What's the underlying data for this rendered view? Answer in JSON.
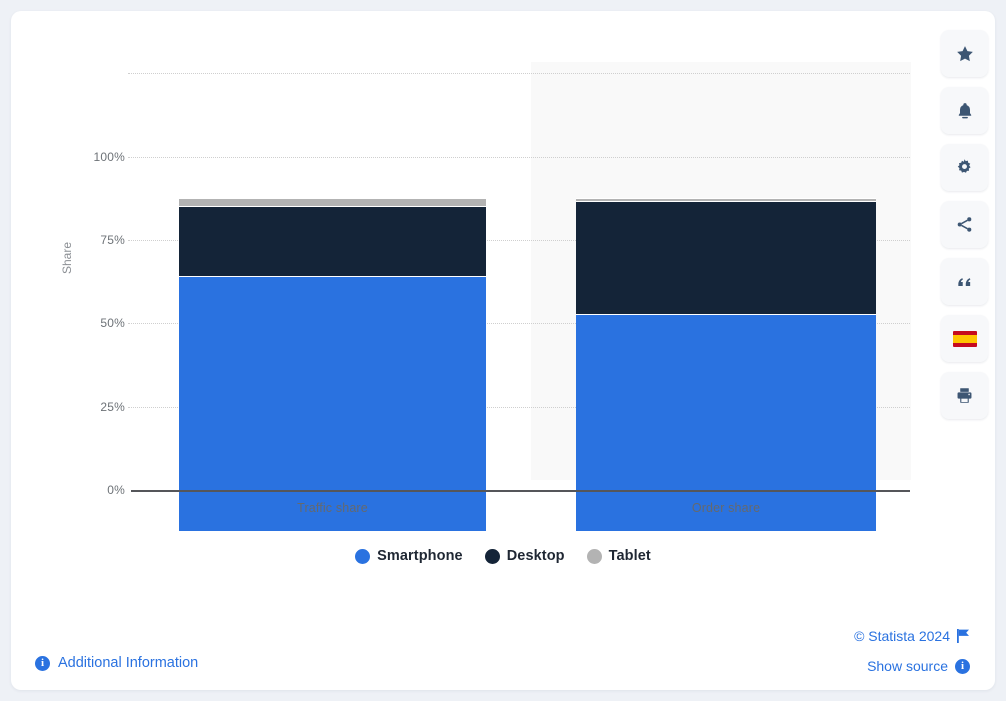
{
  "chart_data": {
    "type": "bar",
    "stacked": true,
    "stacked_mode": "percent",
    "title": "",
    "subtitle": "",
    "xlabel": "",
    "ylabel": "Share",
    "categories": [
      "Traffic share",
      "Order share"
    ],
    "ylim": [
      0,
      125
    ],
    "yticks": [
      "0%",
      "25%",
      "50%",
      "75%",
      "100%"
    ],
    "ytick_values": [
      0,
      25,
      50,
      75,
      100
    ],
    "grid": true,
    "legend_position": "bottom",
    "series": [
      {
        "name": "Smartphone",
        "color": "#2a72e0",
        "values": [
          76.6,
          65.2
        ]
      },
      {
        "name": "Desktop",
        "color": "#142438",
        "values": [
          21.1,
          33.8
        ]
      },
      {
        "name": "Tablet",
        "color": "#b3b3b3",
        "values": [
          2.3,
          1.0
        ]
      }
    ]
  },
  "legend": {
    "items": [
      {
        "label": "Smartphone",
        "color": "#2a72e0"
      },
      {
        "label": "Desktop",
        "color": "#142438"
      },
      {
        "label": "Tablet",
        "color": "#b3b3b3"
      }
    ]
  },
  "footer": {
    "additional_information": "Additional Information",
    "copyright": "© Statista 2024",
    "show_source": "Show source",
    "info_glyph": "i"
  },
  "toolbar": {
    "items": [
      {
        "name": "favorite-star-icon",
        "title": "Favorite"
      },
      {
        "name": "notification-bell-icon",
        "title": "Notifications"
      },
      {
        "name": "settings-gear-icon",
        "title": "Settings"
      },
      {
        "name": "share-icon",
        "title": "Share"
      },
      {
        "name": "citation-quote-icon",
        "title": "Citation"
      },
      {
        "name": "spanish-flag-icon",
        "title": "Español"
      },
      {
        "name": "print-icon",
        "title": "Print"
      }
    ]
  },
  "colors": {
    "accent": "#2a72e0",
    "smartphone": "#2a72e0",
    "desktop": "#142438",
    "tablet": "#b3b3b3",
    "page_background": "#eef1f6",
    "card_background": "#ffffff",
    "band_background": "#f9f9f9",
    "axis": "#55565a",
    "gridline": "#cfcfcf",
    "tick_text": "#6d7277"
  }
}
